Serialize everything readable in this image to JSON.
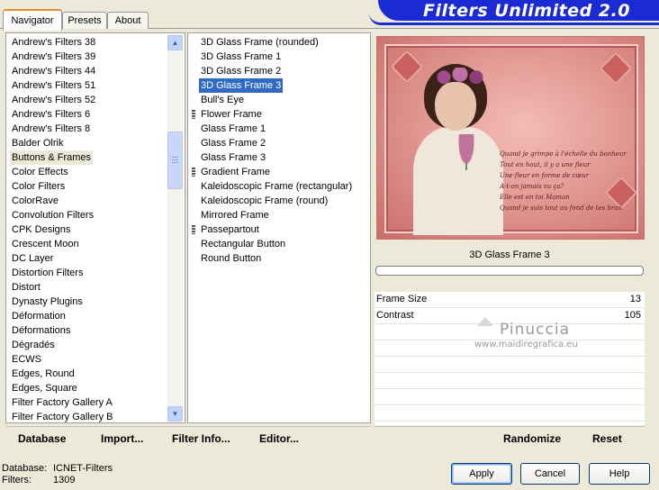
{
  "tabs": [
    {
      "label": "Navigator",
      "active": true
    },
    {
      "label": "Presets",
      "active": false
    },
    {
      "label": "About",
      "active": false
    }
  ],
  "header": {
    "title": "Filters Unlimited 2.0",
    "banner_color": "#1b2bd3"
  },
  "categories": {
    "items": [
      "Andrew's Filters 38",
      "Andrew's Filters 39",
      "Andrew's Filters 44",
      "Andrew's Filters 51",
      "Andrew's Filters 52",
      "Andrew's Filters 6",
      "Andrew's Filters 8",
      "Balder Olrik",
      "Buttons & Frames",
      "Color Effects",
      "Color Filters",
      "ColorRave",
      "Convolution Filters",
      "CPK Designs",
      "Crescent Moon",
      "DC Layer",
      "Distortion Filters",
      "Distort",
      "Dynasty Plugins",
      "Déformation",
      "Déformations",
      "Dégradés",
      "ECWS",
      "Edges, Round",
      "Edges, Square",
      "Filter Factory Gallery A",
      "Filter Factory Gallery B"
    ],
    "selected": "Buttons & Frames"
  },
  "filters": {
    "items": [
      "3D Glass Frame (rounded)",
      "3D Glass Frame 1",
      "3D Glass Frame 2",
      "3D Glass Frame 3",
      "Bull's Eye",
      "Flower Frame",
      "Glass Frame 1",
      "Glass Frame 2",
      "Glass Frame 3",
      "Gradient Frame",
      "Kaleidoscopic Frame (rectangular)",
      "Kaleidoscopic Frame (round)",
      "Mirrored Frame",
      "Passepartout",
      "Rectangular Button",
      "Round Button"
    ],
    "selected": "3D Glass Frame 3"
  },
  "preview": {
    "poem": [
      "Quand je grimpe à l'échelle du bonheur",
      "Tout en haut, il y a une fleur",
      "Une fleur en forme de cœur",
      "A-t-on jamais vu ça?",
      "Elle est en toi Maman",
      "Quand je suis tout au fond de tes bras."
    ]
  },
  "current_filter": "3D Glass Frame 3",
  "params": [
    {
      "label": "Frame Size",
      "value": "13"
    },
    {
      "label": "Contrast",
      "value": "105"
    }
  ],
  "watermark": {
    "line1": "Pinuccia",
    "line2": "www.maidiregrafica.eu"
  },
  "bottom_left": {
    "database": "Database",
    "import": "Import...",
    "filter_info": "Filter Info...",
    "editor": "Editor..."
  },
  "bottom_right": {
    "randomize": "Randomize",
    "reset": "Reset"
  },
  "status": {
    "database_label": "Database:",
    "database_value": "ICNET-Filters",
    "filters_label": "Filters:",
    "filters_value": "1309"
  },
  "buttons": {
    "apply": "Apply",
    "cancel": "Cancel",
    "help": "Help"
  }
}
